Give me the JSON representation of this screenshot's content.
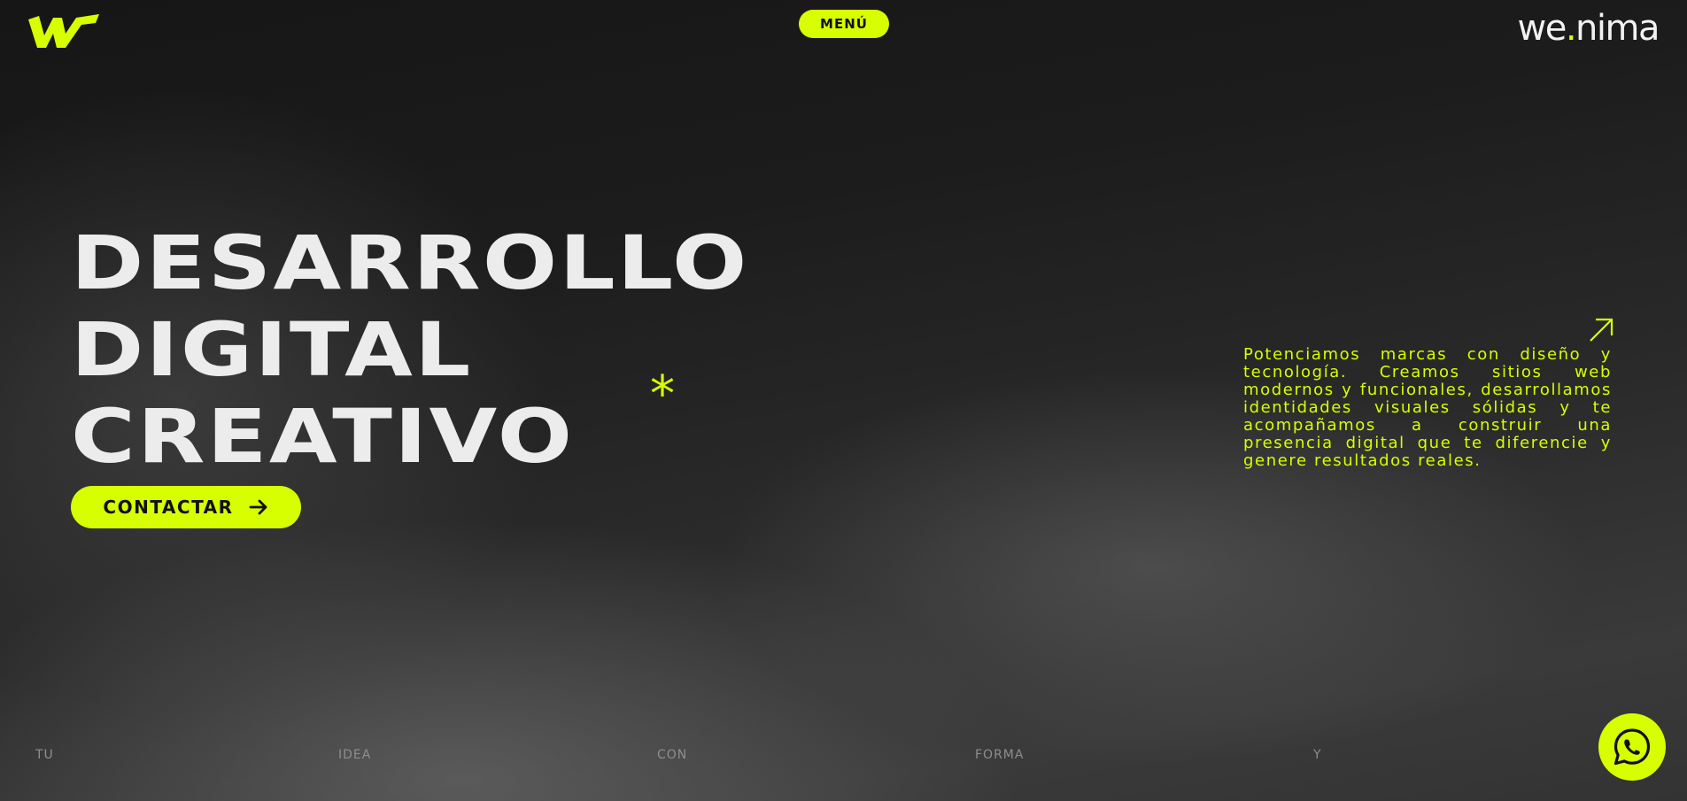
{
  "header": {
    "logo_icon": "w-mark-logo",
    "menu_label": "MENÚ",
    "brand_prefix": "we",
    "brand_dot": ".",
    "brand_suffix": "nima"
  },
  "hero": {
    "title_lines": [
      "DESARROLLO",
      "DIGITAL",
      "CREATIVO"
    ],
    "asterisk": "*",
    "cta_label": "CONTACTAR",
    "cta_icon": "arrow-right-icon"
  },
  "intro": {
    "icon": "arrow-up-right-icon",
    "text": "Potenciamos marcas con diseño y tecnología. Creamos sitios web modernos y funcionales, desarrollamos identidades visuales sólidas y te acompañamos a construir una presencia digital que te diferencie y genere resultados reales."
  },
  "marquee": {
    "words": [
      "TU",
      "IDEA",
      "CON",
      "FORMA",
      "Y"
    ]
  },
  "whatsapp": {
    "icon": "whatsapp-icon"
  },
  "colors": {
    "accent": "#d7ff00",
    "background": "#1e1e1e",
    "text": "#ececec"
  }
}
